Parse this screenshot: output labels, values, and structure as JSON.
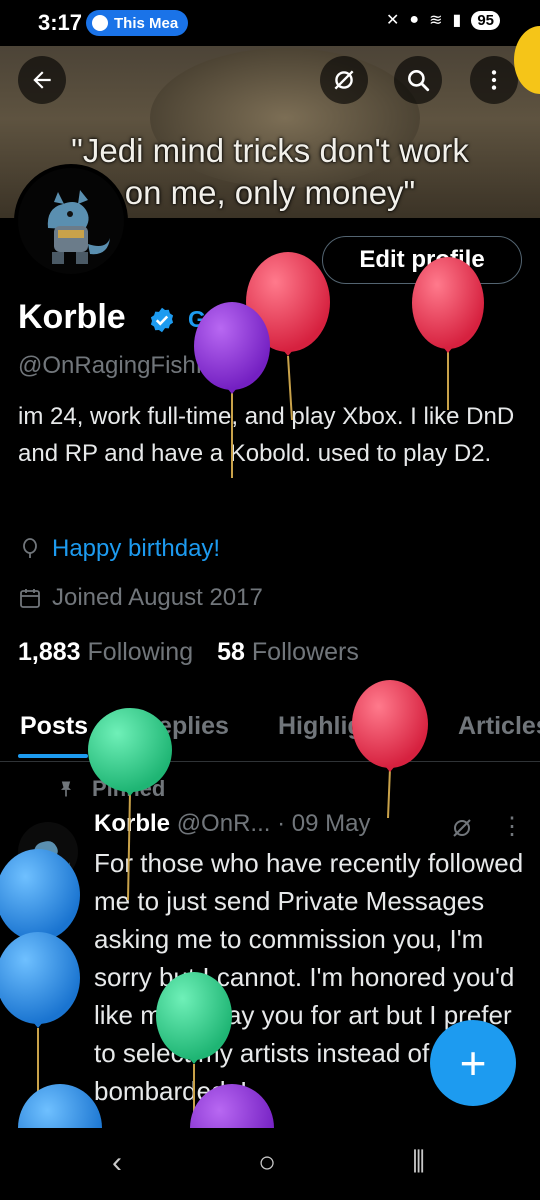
{
  "status_bar": {
    "time": "3:17",
    "media_pill": "This Mea",
    "battery": "95"
  },
  "banner": {
    "quote_line1": "\"Jedi mind tricks don't work",
    "quote_line2": "on me, only money\""
  },
  "header_icons": [
    "back-arrow-icon",
    "grok-icon",
    "search-icon",
    "more-vertical-icon"
  ],
  "profile": {
    "edit_button": "Edit profile",
    "name": "Korble",
    "get_verified": "Get Verified",
    "handle": "@OnRagingFishFTW",
    "bio": "im 24, work full-time, and play Xbox. I like DnD and RP and have a Kobold. used to play D2.",
    "birthday": "Happy birthday!",
    "joined": "Joined August 2017",
    "following_count": "1,883",
    "following_label": "Following",
    "followers_count": "58",
    "followers_label": "Followers"
  },
  "tabs": [
    "Posts",
    "Replies",
    "Highlights",
    "Articles"
  ],
  "post": {
    "pinned_label": "Pinned",
    "name": "Korble",
    "handle": "@OnR...",
    "date": "· 09 May",
    "text": "For those who have recently followed me to just send Private Messages asking me to commission you, I'm sorry but I cannot. I'm honored you'd like me to pay you for art but I prefer to select my artists instead of being bombarded. I"
  },
  "fab_label": "+",
  "colors": {
    "accent": "#1d9bf0",
    "background": "#000000",
    "balloon_red": "#e8334f",
    "balloon_purple": "#8b32d6",
    "balloon_green": "#2ecc8a",
    "balloon_blue": "#2a8fe6"
  }
}
